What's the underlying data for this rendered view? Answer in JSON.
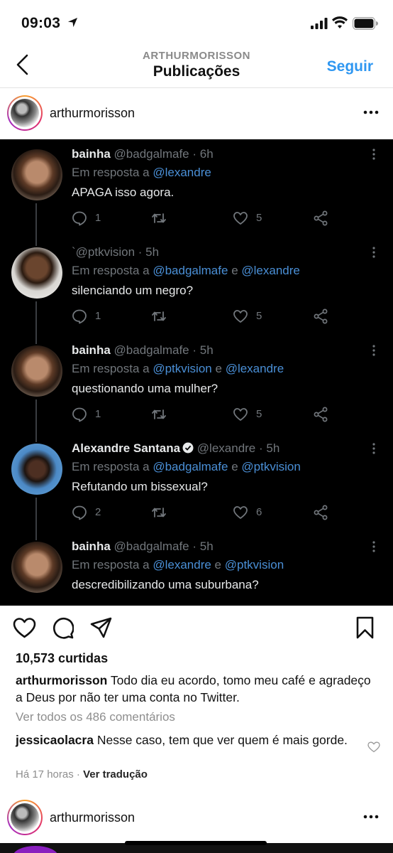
{
  "status_bar": {
    "time": "09:03"
  },
  "nav": {
    "subtitle": "ARTHURMORISSON",
    "title": "Publicações",
    "follow_label": "Seguir"
  },
  "post": {
    "username": "arthurmorisson",
    "likes": "10,573 curtidas",
    "caption_user": "arthurmorisson",
    "caption_text": "Todo dia eu acordo, tomo meu café e agradeço a Deus por não ter uma conta no Twitter.",
    "view_comments": "Ver todos os 486 comentários",
    "comment": {
      "user": "jessicaolacra",
      "text": "Nesse caso, tem que ver quem é mais gorde."
    },
    "time_ago": "Há 17 horas",
    "separator": "·",
    "translate_label": "Ver tradução"
  },
  "next_post": {
    "username": "arthurmorisson"
  },
  "tweets": [
    {
      "name": "bainha",
      "handle": "@badgalmafe · 6h",
      "verified": false,
      "reply_prefix": "Em resposta a",
      "mention1": "@lexandre",
      "reply_join": "",
      "mention2": "",
      "text": "APAGA isso agora.",
      "replies": "1",
      "retweets": "",
      "likes": "5"
    },
    {
      "name": "",
      "handle": "`@ptkvision · 5h",
      "verified": false,
      "reply_prefix": "Em resposta a",
      "mention1": "@badgalmafe",
      "reply_join": "e",
      "mention2": "@lexandre",
      "text": "silenciando um negro?",
      "replies": "1",
      "retweets": "",
      "likes": "5"
    },
    {
      "name": "bainha",
      "handle": "@badgalmafe · 5h",
      "verified": false,
      "reply_prefix": "Em resposta a",
      "mention1": "@ptkvision",
      "reply_join": "e",
      "mention2": "@lexandre",
      "text": "questionando uma mulher?",
      "replies": "1",
      "retweets": "",
      "likes": "5"
    },
    {
      "name": "Alexandre Santana",
      "handle": "@lexandre · 5h",
      "verified": true,
      "reply_prefix": "Em resposta a",
      "mention1": "@badgalmafe",
      "reply_join": "e",
      "mention2": "@ptkvision",
      "text": "Refutando um bissexual?",
      "replies": "2",
      "retweets": "",
      "likes": "6"
    },
    {
      "name": "bainha",
      "handle": "@badgalmafe · 5h",
      "verified": false,
      "reply_prefix": "Em resposta a",
      "mention1": "@lexandre",
      "reply_join": "e",
      "mention2": "@ptkvision",
      "text": "descredibilizando uma suburbana?",
      "replies": "",
      "retweets": "",
      "likes": ""
    }
  ],
  "colors": {
    "accent": "#2f97f1",
    "tweet_bg": "#000000",
    "mention": "#4a8fd6"
  }
}
